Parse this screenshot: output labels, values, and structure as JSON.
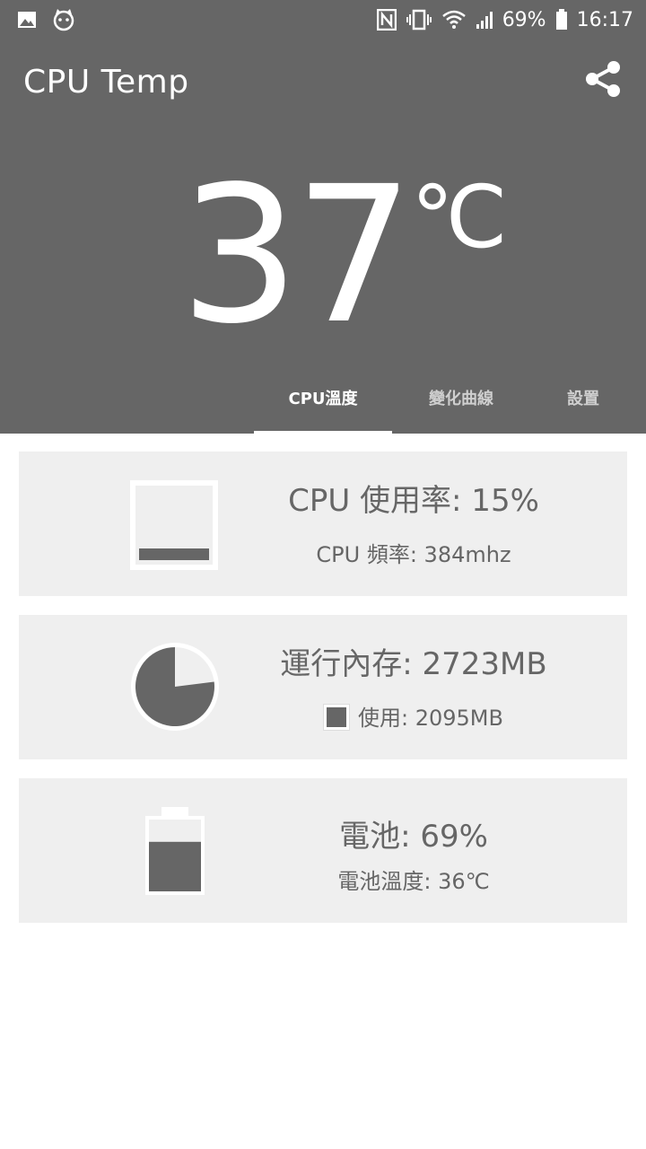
{
  "status_bar": {
    "battery": "69%",
    "time": "16:17",
    "icons": [
      "image-icon",
      "cat-icon",
      "nfc-icon",
      "vibrate-icon",
      "wifi-icon",
      "signal-icon",
      "battery-icon"
    ]
  },
  "app": {
    "title": "CPU Temp",
    "share_icon": "share-icon"
  },
  "temperature": {
    "value": "37",
    "unit": "℃"
  },
  "tabs": [
    {
      "label": "CPU溫度",
      "active": true
    },
    {
      "label": "變化曲線",
      "active": false
    },
    {
      "label": "設置",
      "active": false
    }
  ],
  "cards": {
    "cpu": {
      "title": "CPU 使用率: 15%",
      "subtitle": "CPU 頻率: 384mhz",
      "usage_fraction": 0.15
    },
    "memory": {
      "title": "運行內存: 2723MB",
      "subtitle": "使用: 2095MB",
      "used_fraction": 0.77
    },
    "battery": {
      "title": "電池: 69%",
      "subtitle": "電池溫度: 36℃",
      "level_fraction": 0.69
    }
  },
  "colors": {
    "header": "#666666",
    "card": "#efefef",
    "text": "#666666",
    "accent": "#ffffff"
  }
}
